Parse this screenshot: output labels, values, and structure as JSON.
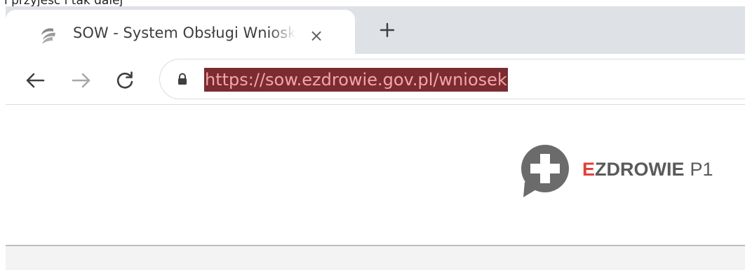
{
  "top_caption": "i przyjeść i tak dalej",
  "tab": {
    "favicon": "sow-swirl-favicon-icon",
    "title": "SOW - System Obsługi Wniosków",
    "close_glyph": "×"
  },
  "toolbar": {
    "back_icon": "back-arrow-icon",
    "forward_icon": "forward-arrow-icon",
    "reload_icon": "reload-icon",
    "lock_icon": "lock-icon",
    "url": "https://sow.ezdrowie.gov.pl/wniosek"
  },
  "page": {
    "brand_initial": "E",
    "brand_rest": "ZDROWIE",
    "brand_suffix": "P1",
    "brand_accent_color": "#e2403a"
  }
}
